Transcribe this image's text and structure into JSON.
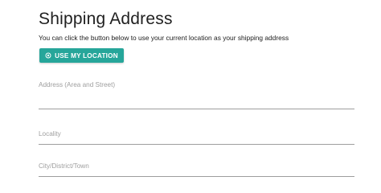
{
  "header": {
    "title": "Shipping Address",
    "subtitle": "You can click the button below to use your current location as your shipping address"
  },
  "location_button": {
    "label": "USE MY LOCATION",
    "icon": "crosshair-location-icon"
  },
  "form": {
    "address": {
      "label": "Address (Area and Street)",
      "value": ""
    },
    "locality": {
      "label": "Locality",
      "value": ""
    },
    "city": {
      "label": "City/District/Town",
      "value": ""
    }
  },
  "colors": {
    "accent": "#26a69a",
    "label": "#9e9e9e",
    "text": "#212121"
  }
}
